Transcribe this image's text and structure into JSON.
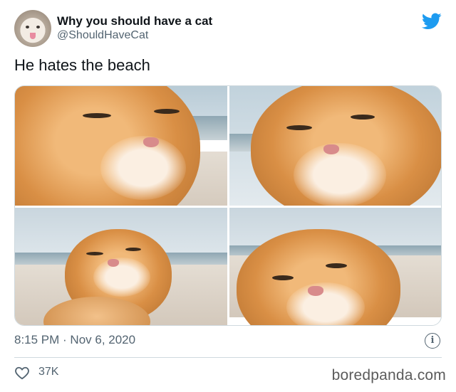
{
  "author": {
    "name": "Why you should have a cat",
    "handle": "@ShouldHaveCat",
    "avatar_icon": "cat-avatar",
    "platform_icon": "twitter-bird-icon",
    "platform_color": "#1d9bf0"
  },
  "tweet": {
    "text": "He hates the beach",
    "media_count": 4,
    "timestamp": "8:15 PM · Nov 6, 2020"
  },
  "actions": {
    "like_icon": "heart-icon",
    "like_count": "37K",
    "info_icon": "info-icon"
  },
  "watermark": "boredpanda.com"
}
